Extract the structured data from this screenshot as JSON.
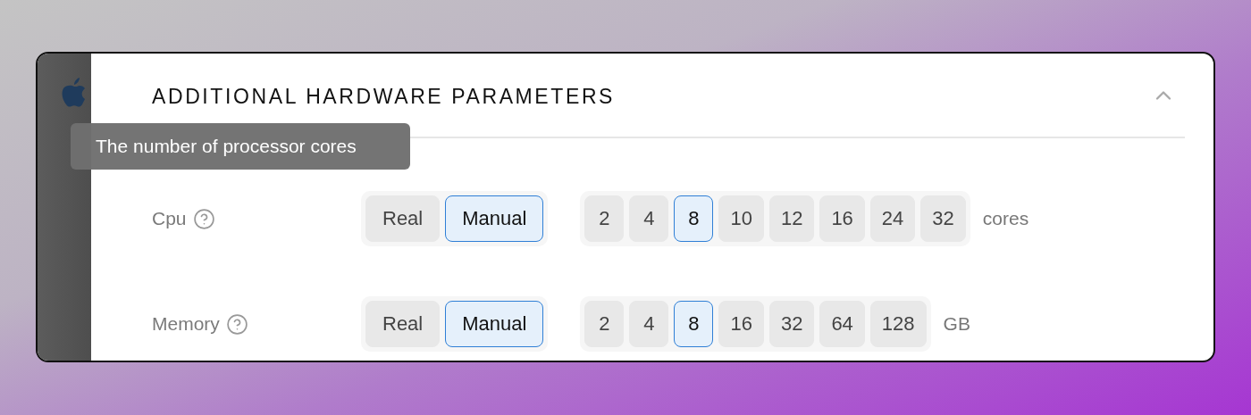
{
  "section": {
    "title": "ADDITIONAL HARDWARE PARAMETERS",
    "expanded": true
  },
  "tooltip": {
    "text": "The number of processor cores"
  },
  "rows": [
    {
      "label": "Cpu",
      "modes": [
        {
          "label": "Real",
          "selected": false
        },
        {
          "label": "Manual",
          "selected": true
        }
      ],
      "values": [
        {
          "label": "2",
          "selected": false
        },
        {
          "label": "4",
          "selected": false
        },
        {
          "label": "8",
          "selected": true
        },
        {
          "label": "10",
          "selected": false
        },
        {
          "label": "12",
          "selected": false
        },
        {
          "label": "16",
          "selected": false
        },
        {
          "label": "24",
          "selected": false
        },
        {
          "label": "32",
          "selected": false
        }
      ],
      "unit": "cores"
    },
    {
      "label": "Memory",
      "modes": [
        {
          "label": "Real",
          "selected": false
        },
        {
          "label": "Manual",
          "selected": true
        }
      ],
      "values": [
        {
          "label": "2",
          "selected": false
        },
        {
          "label": "4",
          "selected": false
        },
        {
          "label": "8",
          "selected": true
        },
        {
          "label": "16",
          "selected": false
        },
        {
          "label": "32",
          "selected": false
        },
        {
          "label": "64",
          "selected": false
        },
        {
          "label": "128",
          "selected": false
        }
      ],
      "unit": "GB"
    }
  ]
}
